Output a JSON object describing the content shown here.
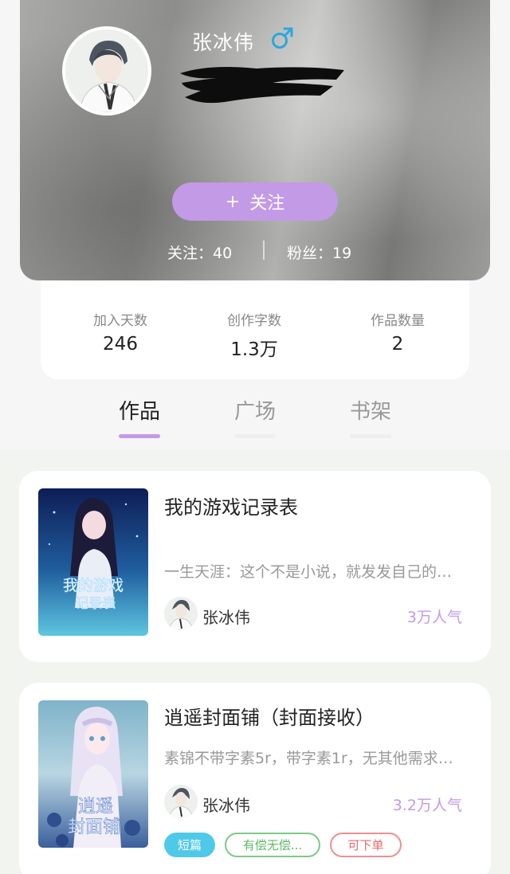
{
  "profile": {
    "username": "张冰伟",
    "gender_icon": "male-icon",
    "follow_button": "关注",
    "follows": "关注：40",
    "fans": "粉丝：19"
  },
  "stats": [
    {
      "label": "加入天数",
      "value": "246"
    },
    {
      "label": "创作字数",
      "value": "1.3万"
    },
    {
      "label": "作品数量",
      "value": "2"
    }
  ],
  "tabs": [
    {
      "label": "作品",
      "active": true
    },
    {
      "label": "广场",
      "active": false
    },
    {
      "label": "书架",
      "active": false
    }
  ],
  "works": [
    {
      "title": "我的游戏记录表",
      "description": "一生天涯：这个不是小说，就发发自己的…",
      "author": "张冰伟",
      "popularity": "3万人气",
      "cover_text": "我的游戏记录表",
      "tags": []
    },
    {
      "title": "逍遥封面铺（封面接收）",
      "description": "素锦不带字素5r，带字素1r，无其他需求…",
      "author": "张冰伟",
      "popularity": "3.2万人气",
      "cover_text": "逍遥封面铺",
      "tags": [
        "短篇",
        "有偿无偿...",
        "可下单"
      ]
    }
  ],
  "colors": {
    "accent": "#c39ae6",
    "tag_short": "#4fc9e8",
    "tag_paid": "#7ec986",
    "tag_order": "#ef8f8f"
  }
}
